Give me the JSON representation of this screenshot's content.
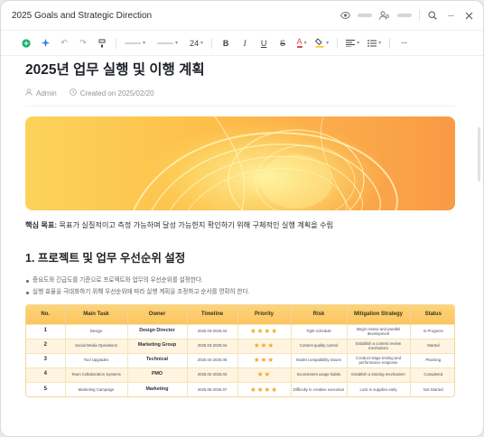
{
  "window": {
    "title": "2025 Goals and Strategic Direction"
  },
  "toolbar": {
    "font_size": "24",
    "buttons": [
      "B",
      "I",
      "U",
      "S",
      "A"
    ]
  },
  "doc": {
    "title": "2025년 업무 실행 및 이행 계획",
    "author": "Admin",
    "created": "Created on 2025/02/20",
    "goal_label": "핵심 목표:",
    "goal_text": " 목표가 실질적이고 측정 가능하며 달성 가능한지 확인하기 위해 구체적인 실행 계획을 수립",
    "section_title": "1. 프로젝트 및 업무 우선순위 설정",
    "bullets": [
      "중요도와 긴급도를 기준으로 프로젝트와 업무의 우선순위를 설정한다.",
      "실행 효율을 극대화하기 위해 우선순위에 따라 실행 계획을 조정하고 순서를 명확히 한다."
    ]
  },
  "table": {
    "headers": [
      "No.",
      "Main Task",
      "Owner",
      "Timeline",
      "Priority",
      "Risk",
      "Mitigation Strategy",
      "Status"
    ],
    "rows": [
      {
        "no": "1",
        "task": "Design",
        "owner": "Design Director",
        "timeline": "2025.03-2025.04",
        "stars": "★★★★",
        "priority": 4,
        "risk": "Tight schedule",
        "mitigation": "Begin review and parallel development",
        "status": "In Progress"
      },
      {
        "no": "2",
        "task": "Social Media Operations",
        "owner": "Marketing Group",
        "timeline": "2025.03-2025.04",
        "stars": "★★★",
        "priority": 3,
        "risk": "Content quality control",
        "mitigation": "Establish a content review mechanism",
        "status": "Started"
      },
      {
        "no": "3",
        "task": "Tool Upgrades",
        "owner": "Technical",
        "timeline": "2025.04-2025.05",
        "stars": "★★★",
        "priority": 3,
        "risk": "Model compatibility issues",
        "mitigation": "Conduct stage testing and performance response",
        "status": "Planning"
      },
      {
        "no": "4",
        "task": "Team Collaboration Systems",
        "owner": "PMO",
        "timeline": "2025.02-2025.03",
        "stars": "★★",
        "priority": 2,
        "risk": "Inconsistent usage habits",
        "mitigation": "Establish a training mechanism",
        "status": "Completed"
      },
      {
        "no": "5",
        "task": "Marketing Campaign",
        "owner": "Marketing",
        "timeline": "2025.06-2025.07",
        "stars": "★★★★",
        "priority": 4,
        "risk": "Difficulty in creative execution",
        "mitigation": "Lock in supplies early",
        "status": "Not Started"
      }
    ]
  },
  "colors": {
    "banner_start": "#fcd35a",
    "banner_end": "#f99a45",
    "star": "#f5a623",
    "accent_green": "#18b26b",
    "accent_blue": "#2f7cf6"
  }
}
